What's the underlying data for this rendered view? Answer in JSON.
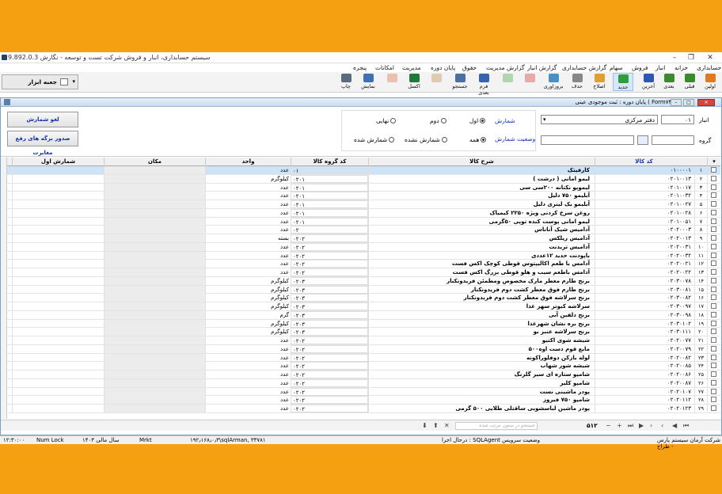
{
  "app": {
    "title": "سیستم حسابداری، انبار و فروش شرکت تست و توسعه - نگارش 9.892.0.3"
  },
  "menu": [
    "حسابداری",
    "خزانه",
    "انبار",
    "فروش",
    "سهام",
    "گزارش حسابداری",
    "گزارش انبار",
    "گزارش مدیریت",
    "حقوق",
    "پایان دوره",
    "مدیریت",
    "امکانات",
    "پنجره"
  ],
  "toolbar": {
    "buttons": [
      "اولین",
      "قبلی",
      "بعدی",
      "آخرین",
      "جدید",
      "اصلاح",
      "حذف",
      "بروزاوری",
      "",
      "",
      "",
      "فرم بعدی",
      "جستجو",
      "",
      "اکسل",
      "",
      "نمایش",
      "چاپ"
    ],
    "toolbox": "جعبه ابزار"
  },
  "form": {
    "title": "پایان دوره : ثبت موجودی عینی ( Form۷۴)"
  },
  "filters": {
    "warehouse_label": "انبار",
    "warehouse_code": "۰۱",
    "warehouse_name": "دفتر مرکزی",
    "group_label": "گروه",
    "count_label": "شمارش",
    "count_options": [
      "اول",
      "دوم",
      "نهایی"
    ],
    "status_label": "وضعیت شمارش",
    "status_options": [
      "همه",
      "شمارش نشده",
      "شمارش شده"
    ],
    "btn_cancel": "لغو شمارش",
    "btn_issue": "صدور برگه های رفع مغایرت"
  },
  "columns": {
    "code": "کد کالا",
    "desc": "شرح کالا",
    "group": "کد گروه کالا",
    "unit": "واحد",
    "loc": "مکان",
    "first": "شمارش اول"
  },
  "rows": [
    {
      "n": "۱",
      "code": "۰۱۰۰۰۰۱",
      "desc": "کارفیتک",
      "group": "۰۱",
      "unit": "عدد"
    },
    {
      "n": "۲",
      "code": "۰۲۰۱۰۰۱۳",
      "desc": "لیمو امانی ( درشت )",
      "group": "۰۲۰۱",
      "unit": "کیلوگرم"
    },
    {
      "n": "۳",
      "code": "۰۲۰۱۰۰۱۷",
      "desc": "لیموپو نکتانه ۲۰۰سی سی",
      "group": "۰۲۰۱",
      "unit": "عدد"
    },
    {
      "n": "۴",
      "code": "۰۲۰۱۰۰۳۲",
      "desc": "آبلیمو ۷۵۰ دلیل",
      "group": "۰۲۰۱",
      "unit": "عدد"
    },
    {
      "n": "۵",
      "code": "۰۲۰۱۰۰۲۷",
      "desc": "آبلیمو یک لیتری دلیل",
      "group": "۰۲۰۱",
      "unit": "عدد"
    },
    {
      "n": "۶",
      "code": "۰۲۰۱۰۰۲۸",
      "desc": "روغن سرخ کردنی ویژه ۲۲۵۰ کیمیاک",
      "group": "۰۲۰۱",
      "unit": "عدد"
    },
    {
      "n": "۷",
      "code": "۰۲۰۱۰۰۵۱",
      "desc": "لیمو امانی پوست کنده توپی ۵۰گرمی",
      "group": "۰۲۰۱",
      "unit": "عدد"
    },
    {
      "n": "۸",
      "code": "۰۲۰۲۰۰۰۳",
      "desc": "آداميس شيک آناناس",
      "group": "۰۲",
      "unit": "عدد"
    },
    {
      "n": "۹",
      "code": "۰۲۰۲۰۰۱۳",
      "desc": "آداميس ريلکس",
      "group": "۰۲۰۲",
      "unit": "بسته"
    },
    {
      "n": "۱۰",
      "code": "۰۲۰۲۰۰۳۱",
      "desc": "آداميس تريدنت",
      "group": "۰۲۰۲",
      "unit": "عدد"
    },
    {
      "n": "۱۱",
      "code": "۰۲۰۲۰۰۳۲",
      "desc": "باپودنت حدید ۱۲عددی",
      "group": "۰۲۰۲",
      "unit": "عدد"
    },
    {
      "n": "۱۲",
      "code": "۰۲۰۲۰۰۲۱",
      "desc": "آدامس با طعم اکالیپتوس قوطی کوچک اکس فست",
      "group": "۰۲۰۲",
      "unit": "عدد"
    },
    {
      "n": "۱۳",
      "code": "۰۲۰۲۰۰۲۲",
      "desc": "آدامس باطعم سیب و هلو قوطی بزرگ اکس فست",
      "group": "۰۲۰۲",
      "unit": "عدد"
    },
    {
      "n": "۱۴",
      "code": "۰۲۰۳۰۰۷۸",
      "desc": "برنج طارم معطر مارک مخصوص ومطمئن فریدونکنار",
      "group": "۰۲۰۳",
      "unit": "کیلوگرم"
    },
    {
      "n": "۱۵",
      "code": "۰۲۰۳۰۰۸۱",
      "desc": "برنج طارم فوق معطر کشت دوم فریدونکنار",
      "group": "۰۲۰۳",
      "unit": "کیلوگرم"
    },
    {
      "n": "۱۶",
      "code": "۰۲۰۳۰۰۸۲",
      "desc": "برنج سرلاشه فوق معطر کشت دوم فریدونکنار",
      "group": "۰۲۰۳",
      "unit": "کیلوگرم"
    },
    {
      "n": "۱۷",
      "code": "۰۲۰۳۰۰۹۷",
      "desc": "سرلاشه کبوتر سهر غذا",
      "group": "۰۲۰۳",
      "unit": "کیلوگرم"
    },
    {
      "n": "۱۸",
      "code": "۰۲۰۳۰۰۹۸",
      "desc": "برنج دلفین آبی",
      "group": "۰۲۰۳",
      "unit": "گرم"
    },
    {
      "n": "۱۹",
      "code": "۰۲۰۳۰۱۰۲",
      "desc": "برنج بره نشان شهرغذا",
      "group": "۰۲۰۳",
      "unit": "کیلوگرم"
    },
    {
      "n": "۲۰",
      "code": "۰۲۰۳۰۱۱۱",
      "desc": "برنج سرلاشه عنبر بو",
      "group": "۰۲۰۳",
      "unit": "کیلوگرم"
    },
    {
      "n": "۲۱",
      "code": "۰۲۰۲۰۰۷۷",
      "desc": "شیشه شوی اکتیو",
      "group": "۰۲۰۲",
      "unit": "عدد"
    },
    {
      "n": "۲۲",
      "code": "۰۲۰۲۰۰۷۹",
      "desc": "مایع قوم دست اوه۵۰۰",
      "group": "۰۲۰۲",
      "unit": "عدد"
    },
    {
      "n": "۲۳",
      "code": "۰۲۰۲۰۰۸۲",
      "desc": "لوله بازکن دوفلوراکونه",
      "group": "۰۲۰۲",
      "unit": "عدد"
    },
    {
      "n": "۲۴",
      "code": "۰۲۰۲۰۰۸۵",
      "desc": "شیشه شور شهاب",
      "group": "۰۲۰۲",
      "unit": "عدد"
    },
    {
      "n": "۲۵",
      "code": "۰۲۰۲۰۰۸۶",
      "desc": "شامپو ستاره ای سیر گلرنگ",
      "group": "۰۲۰۲",
      "unit": "عدد"
    },
    {
      "n": "۲۶",
      "code": "۰۲۰۲۰۰۸۷",
      "desc": "شامپو کلیر",
      "group": "۰۲۰۲",
      "unit": "عدد"
    },
    {
      "n": "۲۷",
      "code": "۰۲۰۲۰۱۰۷",
      "desc": "پودر ماشینی نست",
      "group": "۰۲۰۲",
      "unit": "عدد"
    },
    {
      "n": "۲۸",
      "code": "۰۲۰۲۰۱۱۲",
      "desc": "شامپو ۷۵۰ فیروز",
      "group": "۰۲۰۲",
      "unit": "عدد"
    },
    {
      "n": "۲۹",
      "code": "۰۲۰۲۰۱۲۳",
      "desc": "پودر ماشین لباسشویی ساقتلی طلایی ۵۰۰ گرمی",
      "group": "۰۲۰۲",
      "unit": "عدد"
    }
  ],
  "nav": {
    "count": "۵۱۲",
    "search_placeholder": "جستجو در ستون مرتب شده"
  },
  "status": {
    "company": "شرکت آرمان سیستم پارس - طراح",
    "agent": "درحال اجرا : SQLAgent وضعیت سرویس",
    "server": "۱۹۲٫۱۶۸٫۰٫۳\\sqlArman, ۳۳۷۸۱",
    "mrkt": "Mrkt",
    "year": "سال مالی ۱۴۰۳",
    "numlock": "Num Lock",
    "time": "۱۲:۳۰:۰۰"
  }
}
